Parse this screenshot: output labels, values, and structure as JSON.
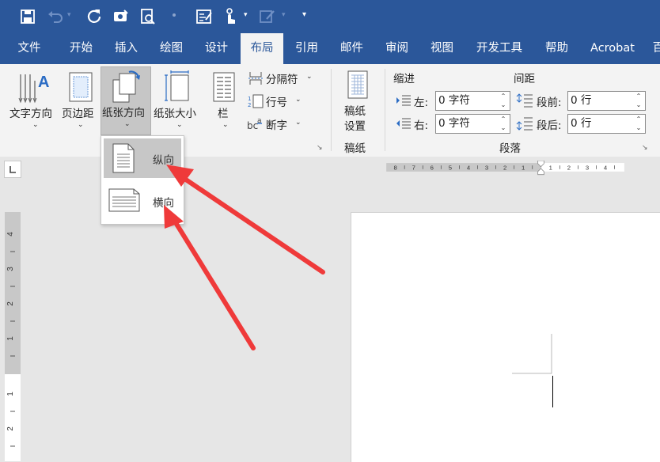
{
  "tabs": [
    {
      "label": "文件",
      "active": false
    },
    {
      "label": "开始",
      "active": false
    },
    {
      "label": "插入",
      "active": false
    },
    {
      "label": "绘图",
      "active": false
    },
    {
      "label": "设计",
      "active": false
    },
    {
      "label": "布局",
      "active": true
    },
    {
      "label": "引用",
      "active": false
    },
    {
      "label": "邮件",
      "active": false
    },
    {
      "label": "审阅",
      "active": false
    },
    {
      "label": "视图",
      "active": false
    },
    {
      "label": "开发工具",
      "active": false
    },
    {
      "label": "帮助",
      "active": false
    },
    {
      "label": "Acrobat",
      "active": false
    },
    {
      "label": "百",
      "active": false
    }
  ],
  "quick_access": [
    "save-icon",
    "undo-icon",
    "redo-icon",
    "touch-mode-icon",
    "print-preview-icon",
    "form-icon",
    "touch-draw-icon",
    "pen-icon",
    "customize-icon"
  ],
  "page_setup": {
    "text_direction": "文字方向",
    "margins": "页边距",
    "orientation": "纸张方向",
    "size": "纸张大小",
    "columns": "栏",
    "breaks": "分隔符",
    "line_numbers": "行号",
    "hyphenation": "断字"
  },
  "manuscript": {
    "settings_line1": "稿纸",
    "settings_line2": "设置",
    "group_label": "稿纸"
  },
  "paragraph": {
    "indent_title": "缩进",
    "spacing_title": "间距",
    "left_label": "左:",
    "left_value": "0 字符",
    "right_label": "右:",
    "right_value": "0 字符",
    "before_label": "段前:",
    "before_value": "0 行",
    "after_label": "段后:",
    "after_value": "0 行",
    "group_label": "段落"
  },
  "orientation_menu": {
    "portrait": "纵向",
    "landscape": "横向",
    "selected": "portrait"
  },
  "hruler_ticks": [
    "8",
    "7",
    "6",
    "5",
    "4",
    "3",
    "2",
    "1",
    "1",
    "2",
    "3",
    "4"
  ],
  "vruler_ticks": [
    "4",
    "3",
    "2",
    "1",
    "1",
    "2"
  ],
  "colors": {
    "brand": "#2b579a",
    "arrow": "#ef3a3a",
    "ribbon": "#f3f3f3"
  }
}
